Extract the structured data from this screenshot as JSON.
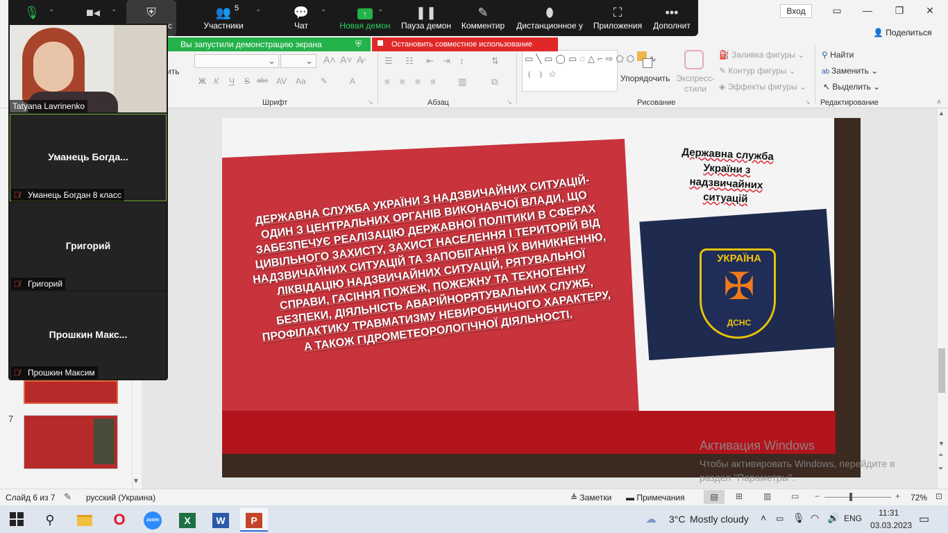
{
  "titlebar": {
    "login_label": "Вход",
    "share_label": "Поделиться"
  },
  "zoom": {
    "participants_count": "5",
    "items": [
      {
        "label": "Участники",
        "icon": "people-icon"
      },
      {
        "label": "Чат",
        "icon": "chat-icon"
      },
      {
        "label": "Новая демон",
        "icon": "share-screen-icon"
      },
      {
        "label": "Пауза демон",
        "icon": "pause-icon"
      },
      {
        "label": "Комментир",
        "icon": "pen-icon"
      },
      {
        "label": "Дистанционное у",
        "icon": "remote-control-icon"
      },
      {
        "label": "Приложения",
        "icon": "apps-icon"
      },
      {
        "label": "Дополнит",
        "icon": "more-icon"
      }
    ],
    "security_partial": "с",
    "share_banner": "Вы запустили демонстрацию экрана",
    "stop_banner": "Остановить совместное использование",
    "tiles": [
      {
        "name": "",
        "label": "Tatyana Lavrinenko"
      },
      {
        "name": "Уманець  Богда...",
        "label": "Уманець Богдан 8 класс"
      },
      {
        "name": "Григорий",
        "label": "Григорий"
      },
      {
        "name": "Прошкин  Макс...",
        "label": "Прошкин Максим"
      }
    ]
  },
  "ribbon": {
    "groups": {
      "font": "Шрифт",
      "paragraph": "Абзац",
      "drawing": "Рисование",
      "editing": "Редактирование"
    },
    "arrange_label": "Упорядочить",
    "styles_label": "Экспресс-стили",
    "shape_fill": "Заливка фигуры",
    "shape_outline": "Контур фигуры",
    "shape_effects": "Эффекты фигуры",
    "find": "Найти",
    "replace": "Заменить",
    "select": "Выделить",
    "partial_left": "ить",
    "font_buttons": [
      "Ж",
      "К",
      "Ч",
      "S",
      "abc",
      "AV",
      "Aa",
      "A"
    ]
  },
  "slides": {
    "thumb_number": "7"
  },
  "slide": {
    "title": "Державна служба України з надзвичайних ситуацій",
    "body": "Державна служба України з надзвичайних ситуацій- один з центральних органів виконавчої влади, що забезпечує реалізацію державної політики в сферах цивільного захисту, захист населення і територій від надзвичайних ситуацій та запобігання їх виникненню, ліквідацію надзвичайних ситуацій, рятувальної справи, гасіння пожеж, пожежну та техногенну безпеки, діяльність аварійнорятувальних служб, профілактику травматизму невиробничого характеру, а також гідрометеорологічної діяльності.",
    "emblem_top": "УКРАЇНА",
    "emblem_bottom": "ДСНС"
  },
  "watermark": {
    "title": "Активация Windows",
    "text": "Чтобы активировать Windows, перейдите в раздел \"Параметры\"."
  },
  "status": {
    "slide_counter": "Слайд 6 из 7",
    "language": "русский (Украина)",
    "notes": "Заметки",
    "comments": "Примечания",
    "zoom_level": "72%",
    "zoom_fraction": 0.4
  },
  "taskbar": {
    "weather_temp": "3°C",
    "weather_text": "Mostly cloudy",
    "lang": "ENG",
    "time": "11:31",
    "date": "03.03.2023"
  }
}
